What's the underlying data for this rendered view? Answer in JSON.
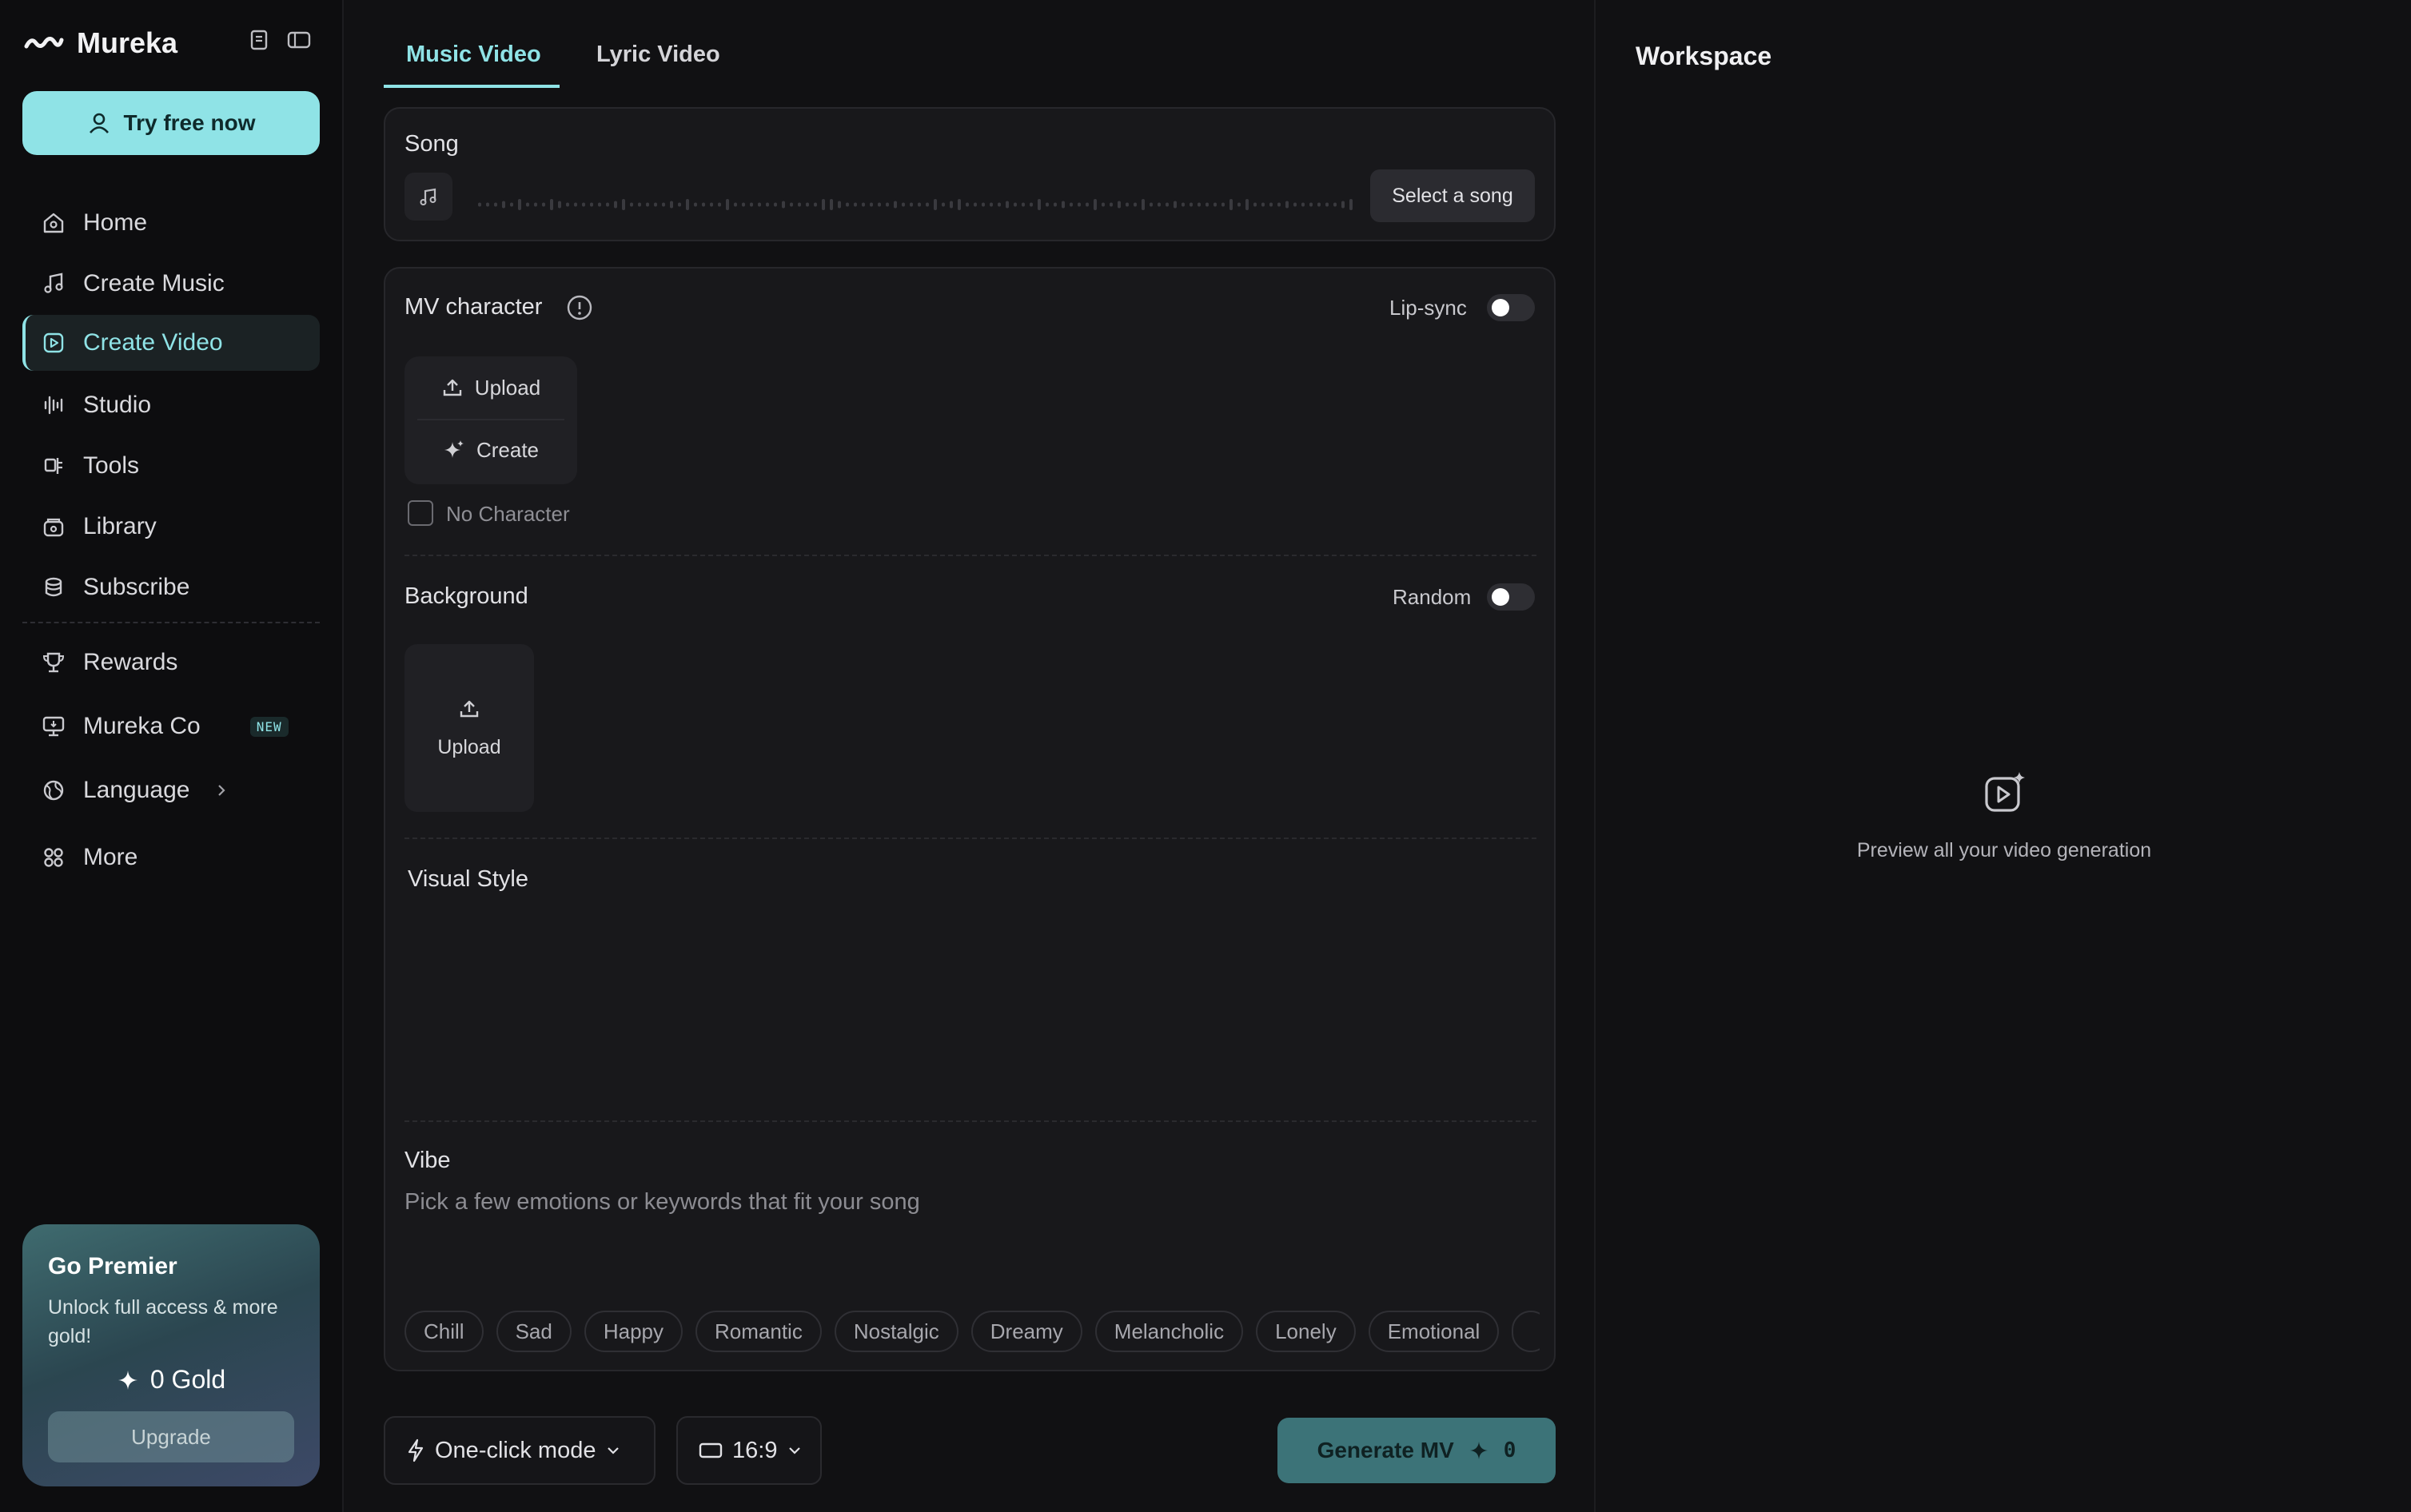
{
  "brand": {
    "name": "Mureka",
    "icon": "mureka-logo-icon"
  },
  "sidebar": {
    "try_label": "Try free now",
    "items": [
      {
        "label": "Home",
        "icon": "home-icon"
      },
      {
        "label": "Create Music",
        "icon": "music-note-icon"
      },
      {
        "label": "Create Video",
        "icon": "video-icon",
        "active": true
      },
      {
        "label": "Studio",
        "icon": "waveform-icon"
      },
      {
        "label": "Tools",
        "icon": "tools-icon"
      },
      {
        "label": "Library",
        "icon": "library-icon"
      },
      {
        "label": "Subscribe",
        "icon": "coins-icon"
      }
    ],
    "secondary_items": [
      {
        "label": "Rewards",
        "icon": "trophy-icon"
      },
      {
        "label": "Mureka Co",
        "icon": "monitor-icon",
        "badge": "NEW"
      },
      {
        "label": "Language",
        "icon": "globe-icon"
      },
      {
        "label": "More",
        "icon": "grid-icon"
      }
    ],
    "premier": {
      "title": "Go Premier",
      "subtitle": "Unlock full access & more gold!",
      "gold": "0 Gold",
      "upgrade_label": "Upgrade"
    }
  },
  "tabs": [
    {
      "label": "Music Video",
      "active": true
    },
    {
      "label": "Lyric Video",
      "active": false
    }
  ],
  "song": {
    "title": "Song",
    "select_label": "Select a song"
  },
  "character": {
    "title": "MV character",
    "lipsync_label": "Lip-sync",
    "lipsync_on": false,
    "upload_label": "Upload",
    "create_label": "Create",
    "no_character_label": "No Character"
  },
  "background": {
    "title": "Background",
    "random_label": "Random",
    "random_on": false,
    "upload_label": "Upload"
  },
  "visual_style": {
    "title": "Visual Style"
  },
  "vibe": {
    "title": "Vibe",
    "placeholder": "Pick a few emotions or keywords that fit your song",
    "chips": [
      "Chill",
      "Sad",
      "Happy",
      "Romantic",
      "Nostalgic",
      "Dreamy",
      "Melancholic",
      "Lonely",
      "Emotional"
    ]
  },
  "footer": {
    "mode_label": "One-click mode",
    "ratio_label": "16:9",
    "generate_label": "Generate MV",
    "generate_cost": "0"
  },
  "workspace": {
    "title": "Workspace",
    "empty_text": "Preview all your video generation"
  },
  "colors": {
    "accent": "#8fe3e6",
    "background": "#111113",
    "card": "#18181b",
    "generate": "#3c7378"
  }
}
